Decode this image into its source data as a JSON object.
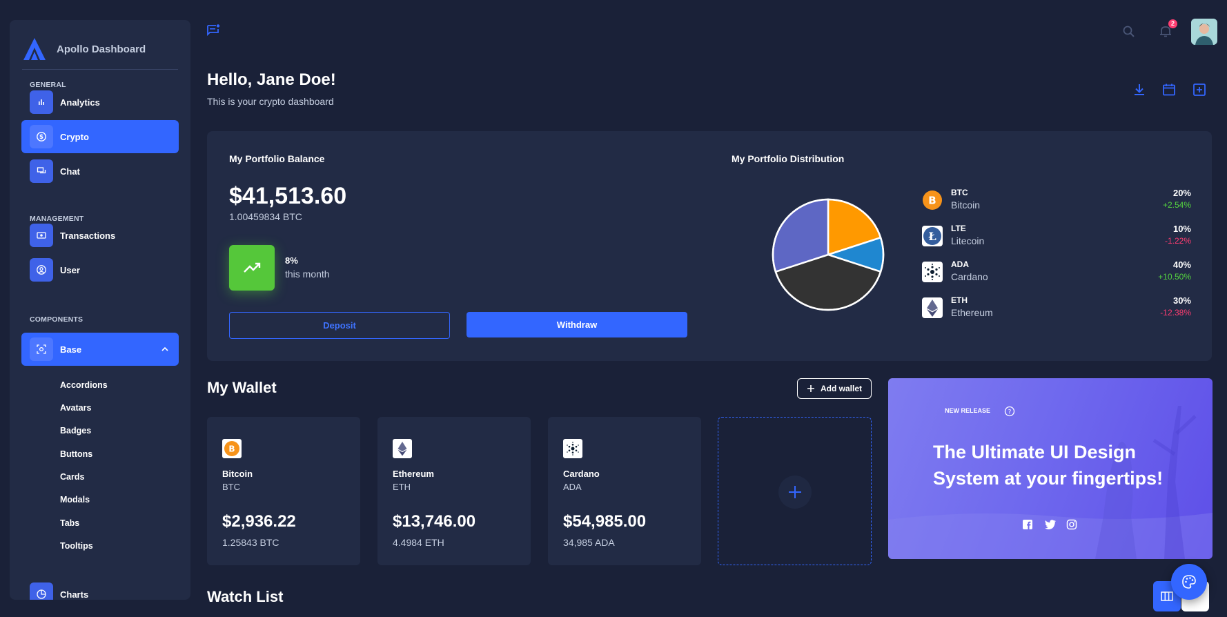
{
  "brand": {
    "name": "Apollo Dashboard"
  },
  "sidebar": {
    "sections": [
      {
        "title": "GENERAL"
      },
      {
        "title": "MANAGEMENT"
      },
      {
        "title": "COMPONENTS"
      }
    ],
    "items": [
      {
        "label": "Analytics",
        "icon": "bar-chart-icon"
      },
      {
        "label": "Crypto",
        "icon": "dollar-icon",
        "active": true
      },
      {
        "label": "Chat",
        "icon": "chat-icon"
      },
      {
        "label": "Transactions",
        "icon": "cash-icon"
      },
      {
        "label": "User",
        "icon": "user-icon"
      },
      {
        "label": "Base",
        "icon": "scan-icon",
        "expanded": true
      },
      {
        "label": "Charts",
        "icon": "pie-icon"
      }
    ],
    "sub_items": [
      "Accordions",
      "Avatars",
      "Badges",
      "Buttons",
      "Cards",
      "Modals",
      "Tabs",
      "Tooltips"
    ]
  },
  "topbar": {
    "notifications_count": "2"
  },
  "header": {
    "greeting": "Hello, Jane Doe!",
    "subtitle": "This is your crypto dashboard"
  },
  "portfolio": {
    "balance_title": "My Portfolio Balance",
    "balance": "$41,513.60",
    "balance_btc": "1.00459834 BTC",
    "trend_pct": "8%",
    "trend_label": "this month",
    "deposit_label": "Deposit",
    "withdraw_label": "Withdraw",
    "distribution_title": "My Portfolio Distribution",
    "coins": [
      {
        "symbol": "BTC",
        "name": "Bitcoin",
        "pct": "20%",
        "change": "+2.54%",
        "trend": "up"
      },
      {
        "symbol": "LTE",
        "name": "Litecoin",
        "pct": "10%",
        "change": "-1.22%",
        "trend": "down"
      },
      {
        "symbol": "ADA",
        "name": "Cardano",
        "pct": "40%",
        "change": "+10.50%",
        "trend": "up"
      },
      {
        "symbol": "ETH",
        "name": "Ethereum",
        "pct": "30%",
        "change": "-12.38%",
        "trend": "down"
      }
    ],
    "pie": [
      {
        "name": "BTC",
        "value": 20,
        "color": "#ff9900"
      },
      {
        "name": "LTE",
        "value": 10,
        "color": "#1f87d0"
      },
      {
        "name": "ADA",
        "value": 40,
        "color": "#333333"
      },
      {
        "name": "ETH",
        "value": 30,
        "color": "#5e67c4"
      }
    ]
  },
  "wallet": {
    "title": "My Wallet",
    "add_label": "Add wallet",
    "cards": [
      {
        "name": "Bitcoin",
        "symbol": "BTC",
        "value": "$2,936.22",
        "amount": "1.25843 BTC"
      },
      {
        "name": "Ethereum",
        "symbol": "ETH",
        "value": "$13,746.00",
        "amount": "4.4984 ETH"
      },
      {
        "name": "Cardano",
        "symbol": "ADA",
        "value": "$54,985.00",
        "amount": "34,985 ADA"
      }
    ]
  },
  "promo": {
    "tag": "NEW RELEASE",
    "title": "The Ultimate UI Design System at your fingertips!"
  },
  "watchlist": {
    "title": "Watch List"
  },
  "colors": {
    "accent": "#3366ff",
    "bg": "#1a2138",
    "card": "#222b45",
    "positive": "#55d340",
    "negative": "#ff3d71"
  }
}
